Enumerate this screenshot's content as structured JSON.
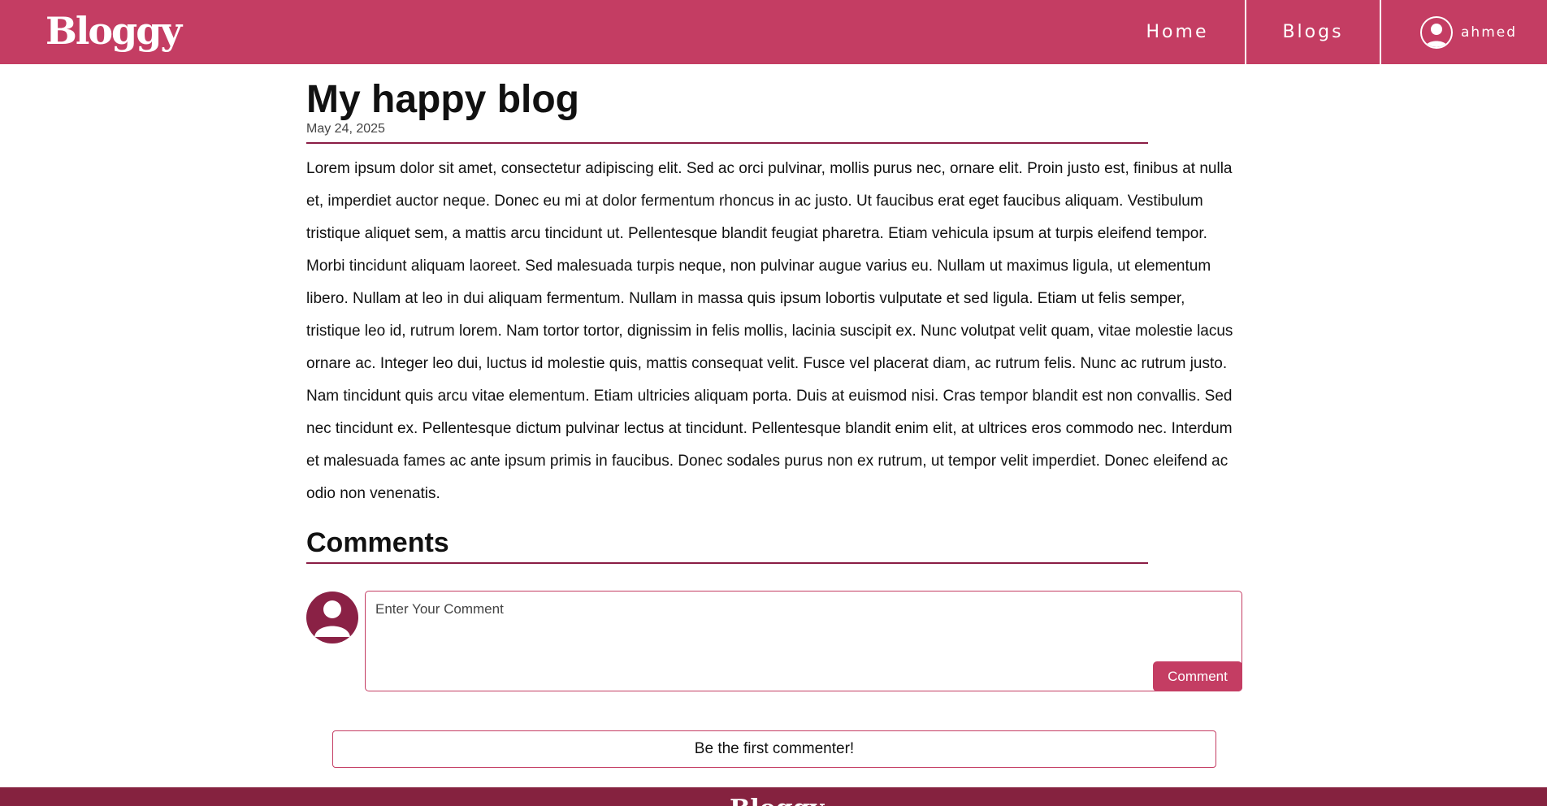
{
  "header": {
    "brand": "Bloggy",
    "nav": [
      {
        "label": "Home"
      },
      {
        "label": "Blogs"
      }
    ],
    "user": {
      "name": "ahmed",
      "icon": "user-avatar-icon"
    }
  },
  "post": {
    "title": "My happy blog",
    "date": "May 24, 2025",
    "body": "Lorem ipsum dolor sit amet, consectetur adipiscing elit. Sed ac orci pulvinar, mollis purus nec, ornare elit. Proin justo est, finibus at nulla et, imperdiet auctor neque. Donec eu mi at dolor fermentum rhoncus in ac justo. Ut faucibus erat eget faucibus aliquam. Vestibulum tristique aliquet sem, a mattis arcu tincidunt ut. Pellentesque blandit feugiat pharetra. Etiam vehicula ipsum at turpis eleifend tempor. Morbi tincidunt aliquam laoreet. Sed malesuada turpis neque, non pulvinar augue varius eu. Nullam ut maximus ligula, ut elementum libero. Nullam at leo in dui aliquam fermentum. Nullam in massa quis ipsum lobortis vulputate et sed ligula. Etiam ut felis semper, tristique leo id, rutrum lorem. Nam tortor tortor, dignissim in felis mollis, lacinia suscipit ex. Nunc volutpat velit quam, vitae molestie lacus ornare ac. Integer leo dui, luctus id molestie quis, mattis consequat velit. Fusce vel placerat diam, ac rutrum felis. Nunc ac rutrum justo. Nam tincidunt quis arcu vitae elementum. Etiam ultricies aliquam porta. Duis at euismod nisi. Cras tempor blandit est non convallis. Sed nec tincidunt ex. Pellentesque dictum pulvinar lectus at tincidunt. Pellentesque blandit enim elit, at ultrices eros commodo nec. Interdum et malesuada fames ac ante ipsum primis in faucibus. Donec sodales purus non ex rutrum, ut tempor velit imperdiet. Donec eleifend ac odio non venenatis."
  },
  "comments": {
    "heading": "Comments",
    "input_placeholder": "Enter Your Comment",
    "input_value": "",
    "submit_label": "Comment",
    "empty_message": "Be the first commenter!",
    "avatar_icon": "user-avatar-icon"
  },
  "footer": {
    "brand": "Bloggy"
  },
  "colors": {
    "primary": "#c43d63",
    "dark": "#85223f",
    "rule": "#8a1d45"
  }
}
